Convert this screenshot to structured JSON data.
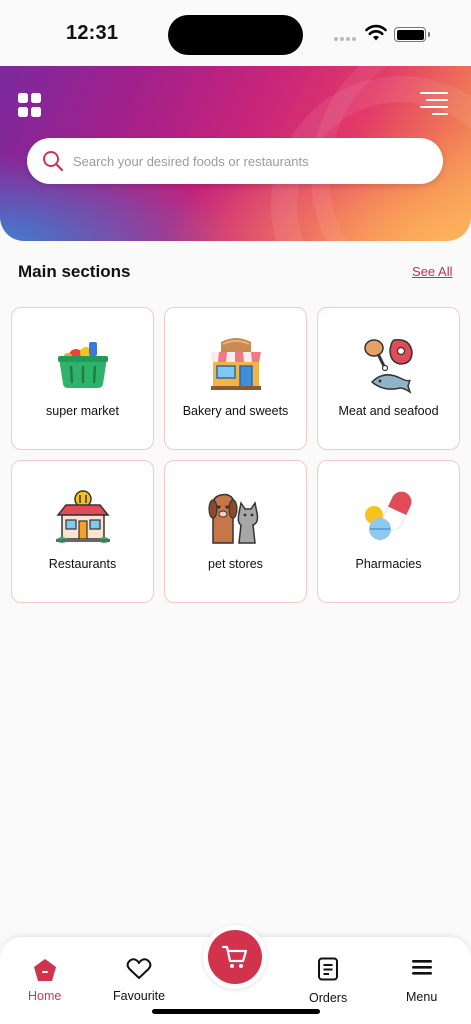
{
  "status_bar": {
    "time": "12:31"
  },
  "header": {
    "menu_grid_icon": "grid-icon",
    "menu_lines_icon": "menu-lines-icon",
    "search": {
      "placeholder": "Search your desired foods or restaurants",
      "value": ""
    }
  },
  "main": {
    "section_title": "Main sections",
    "see_all": "See All",
    "categories": [
      {
        "label": "super market",
        "icon": "grocery-basket-icon"
      },
      {
        "label": "Bakery and sweets",
        "icon": "bakery-shop-icon"
      },
      {
        "label": "Meat and seafood",
        "icon": "meat-fish-icon"
      },
      {
        "label": "Restaurants",
        "icon": "restaurant-icon"
      },
      {
        "label": "pet stores",
        "icon": "pets-icon"
      },
      {
        "label": "Pharmacies",
        "icon": "pills-icon"
      }
    ]
  },
  "bottom_nav": {
    "items": [
      {
        "label": "Home",
        "icon": "home-icon",
        "active": true
      },
      {
        "label": "Favourite",
        "icon": "heart-icon"
      },
      {
        "label": "Orders",
        "icon": "orders-icon"
      },
      {
        "label": "Menu",
        "icon": "menu-icon"
      }
    ],
    "cart_icon": "cart-icon"
  },
  "colors": {
    "accent": "#d0334b",
    "card_border": "#f3c7ce"
  }
}
